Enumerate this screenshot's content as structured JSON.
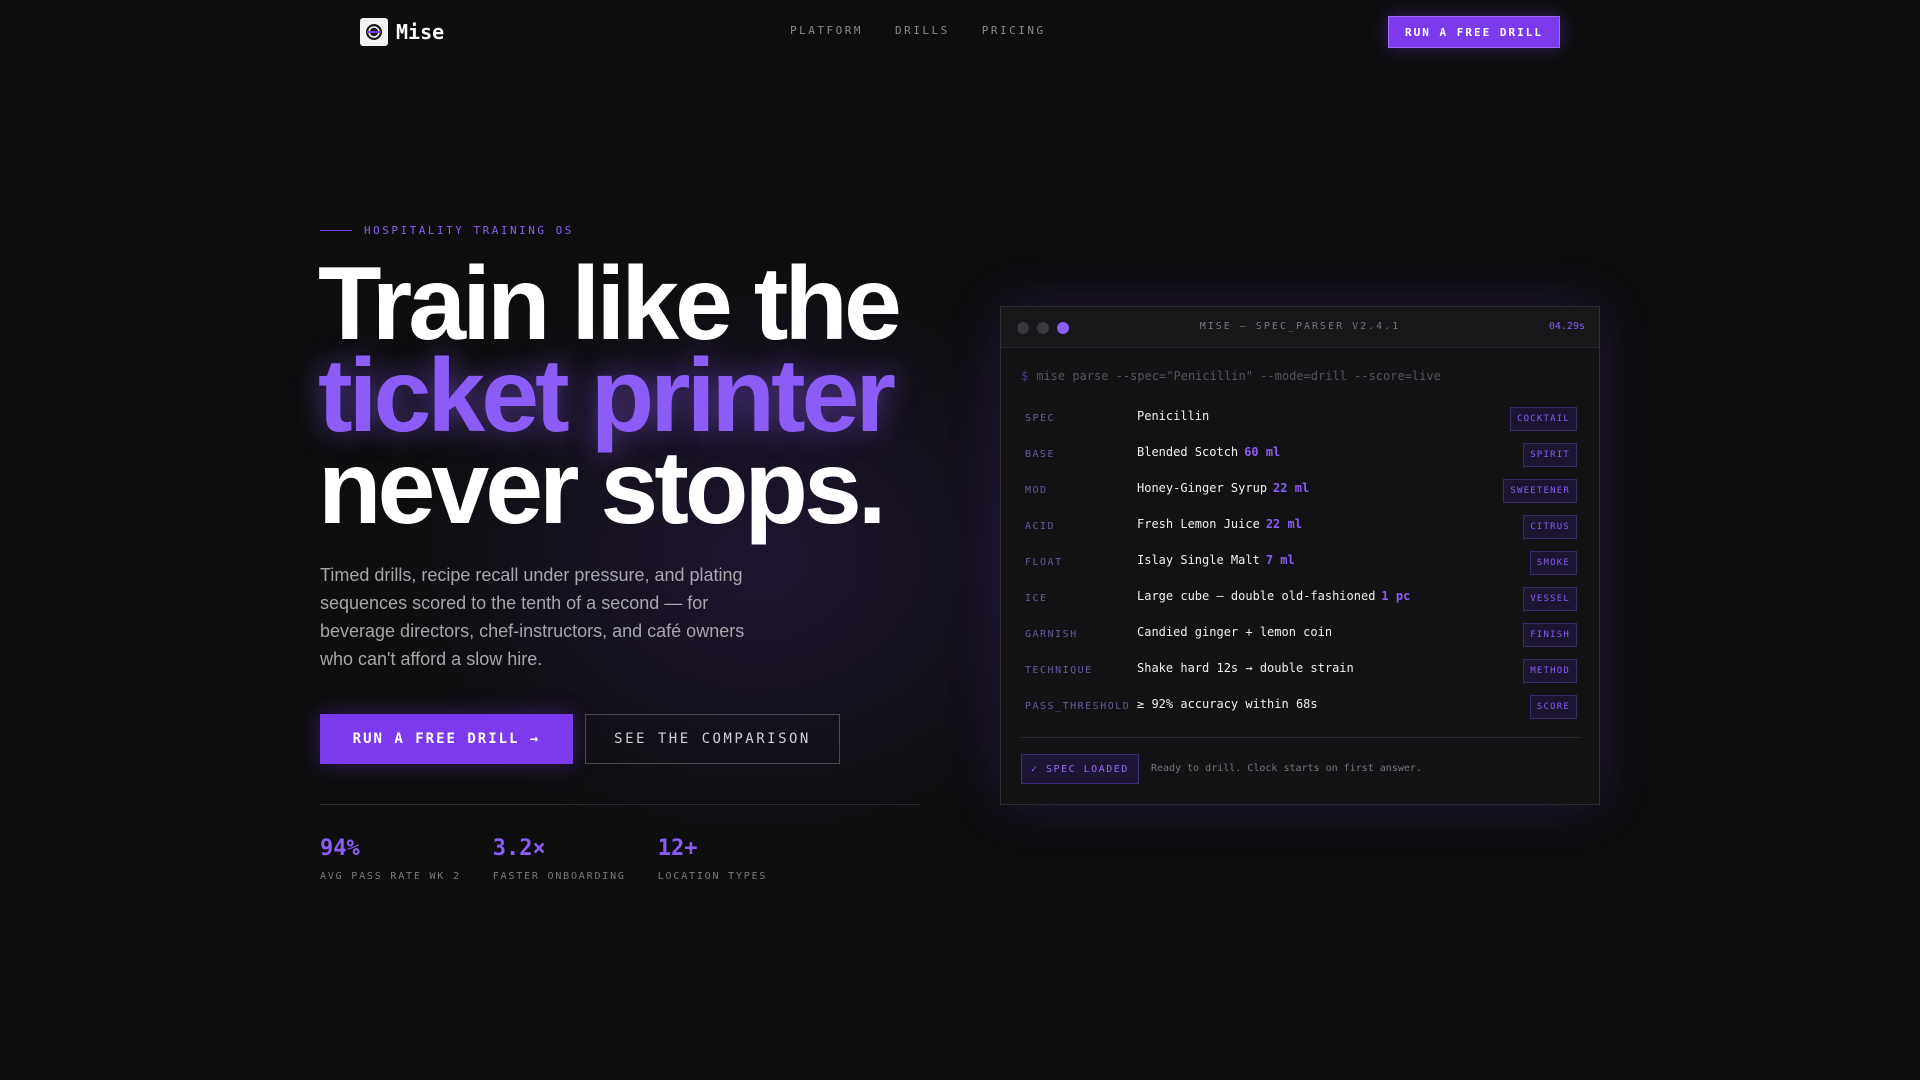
{
  "nav": {
    "logo_text": "Mise",
    "logo_icon": "mise-logo-icon",
    "links": [
      "PLATFORM",
      "DRILLS",
      "PRICING"
    ],
    "cta": "RUN A FREE DRILL"
  },
  "hero": {
    "eyebrow": "HOSPITALITY TRAINING OS",
    "headline_1": "Train like the",
    "headline_2": "ticket printer",
    "headline_3": "never stops.",
    "subtitle": "Timed drills, recipe recall under pressure, and plating sequences scored to the tenth of a second — for beverage directors, chef-instructors, and café owners who can't afford a slow hire.",
    "primary_button": "RUN A FREE DRILL →",
    "secondary_button": "SEE THE COMPARISON",
    "stats": [
      {
        "value": "94%",
        "label": "AVG PASS RATE WK 2"
      },
      {
        "value": "3.2×",
        "label": "FASTER ONBOARDING"
      },
      {
        "value": "12+",
        "label": "LOCATION TYPES"
      }
    ]
  },
  "terminal": {
    "title": "MISE — SPEC_PARSER V2.4.1",
    "timer": "04.29s",
    "prompt": "$",
    "command": "mise parse --spec=\"Penicillin\" --mode=drill --score=live",
    "rows": [
      {
        "key": "SPEC",
        "value": "Penicillin",
        "qty": "",
        "tag": "COCKTAIL"
      },
      {
        "key": "BASE",
        "value": "Blended Scotch",
        "qty": "60 ml",
        "tag": "SPIRIT"
      },
      {
        "key": "MOD",
        "value": "Honey-Ginger Syrup",
        "qty": "22 ml",
        "tag": "SWEETENER"
      },
      {
        "key": "ACID",
        "value": "Fresh Lemon Juice",
        "qty": "22 ml",
        "tag": "CITRUS"
      },
      {
        "key": "FLOAT",
        "value": "Islay Single Malt",
        "qty": "7 ml",
        "tag": "SMOKE"
      },
      {
        "key": "ICE",
        "value": "Large cube — double old-fashioned",
        "qty": "1 pc",
        "tag": "VESSEL"
      },
      {
        "key": "GARNISH",
        "value": "Candied ginger + lemon coin",
        "qty": "",
        "tag": "FINISH"
      },
      {
        "key": "TECHNIQUE",
        "value": "Shake hard 12s → double strain",
        "qty": "",
        "tag": "METHOD"
      },
      {
        "key": "PASS_THRESHOLD",
        "value": "≥ 92% accuracy within 68s",
        "qty": "",
        "tag": "SCORE"
      }
    ],
    "status_badge": "✓ SPEC LOADED",
    "status_text": "Ready to drill. Clock starts on first answer."
  },
  "colors": {
    "accent": "#7c3aed",
    "accent_light": "#8b5cf6",
    "background": "#0d0d0e"
  }
}
